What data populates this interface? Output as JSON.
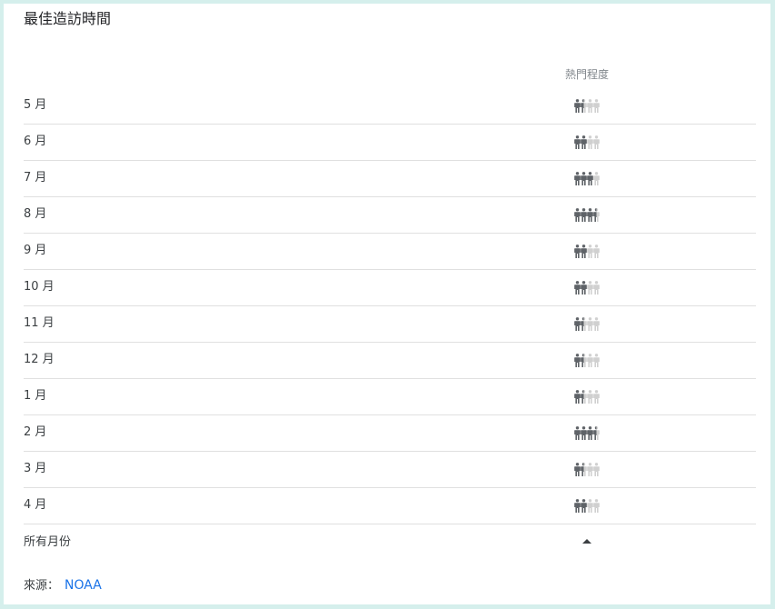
{
  "title": "最佳造訪時間",
  "column_header": "熱門程度",
  "colors": {
    "person_filled": "#5f6368",
    "person_empty": "#d0d0d0",
    "link": "#1a73e8",
    "background": "#d5efec"
  },
  "icon": "person-icon",
  "months": [
    {
      "label": "5 月",
      "popularity": 1.5
    },
    {
      "label": "6 月",
      "popularity": 2
    },
    {
      "label": "7 月",
      "popularity": 3
    },
    {
      "label": "8 月",
      "popularity": 3.5
    },
    {
      "label": "9 月",
      "popularity": 2
    },
    {
      "label": "10 月",
      "popularity": 2
    },
    {
      "label": "11 月",
      "popularity": 1.5
    },
    {
      "label": "12 月",
      "popularity": 1.5
    },
    {
      "label": "1 月",
      "popularity": 1.5
    },
    {
      "label": "2 月",
      "popularity": 3.5
    },
    {
      "label": "3 月",
      "popularity": 1.5
    },
    {
      "label": "4 月",
      "popularity": 2
    }
  ],
  "max_popularity": 4,
  "all_months_label": "所有月份",
  "source_label": "來源：",
  "source_link": "NOAA"
}
